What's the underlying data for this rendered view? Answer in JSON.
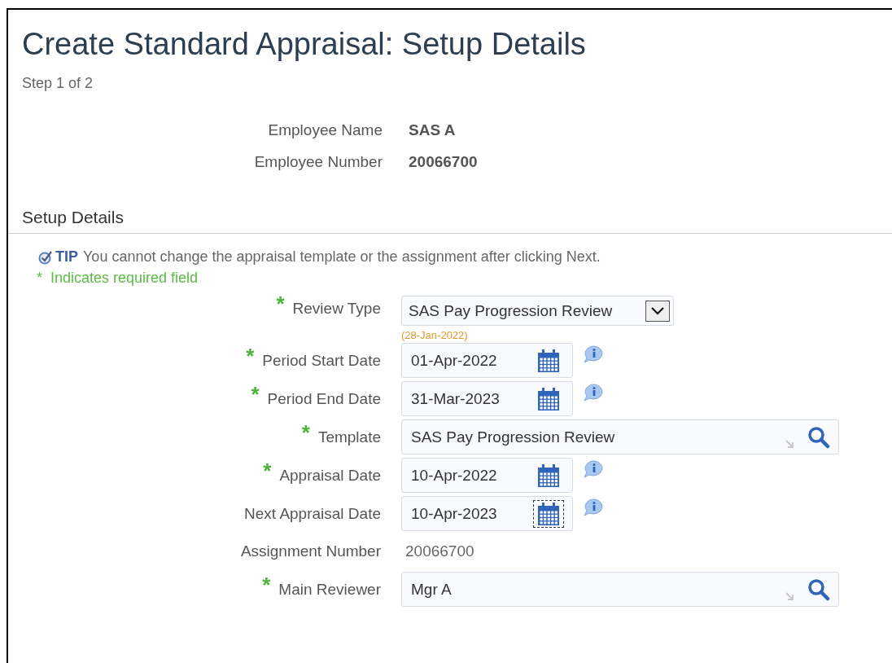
{
  "page": {
    "title": "Create Standard Appraisal: Setup Details",
    "step": "Step 1 of 2"
  },
  "employee": [
    {
      "label": "Employee Name",
      "value": "SAS A"
    },
    {
      "label": "Employee Number",
      "value": "20066700"
    }
  ],
  "section": {
    "title": "Setup Details",
    "tip_label": "TIP",
    "tip_text": "You cannot change the appraisal template or the assignment after clicking Next.",
    "required_mark": "*",
    "required_note": "Indicates required field"
  },
  "fields": [
    {
      "kind": "select",
      "label": "Review Type",
      "required": true,
      "value": "SAS Pay Progression Review"
    },
    {
      "kind": "date",
      "label": "Period Start Date",
      "required": true,
      "value": "01-Apr-2022",
      "hint": "(28-Jan-2022)",
      "calendar_focused": false
    },
    {
      "kind": "date",
      "label": "Period End Date",
      "required": true,
      "value": "31-Mar-2023",
      "calendar_focused": false
    },
    {
      "kind": "lov",
      "label": "Template",
      "required": true,
      "value": "SAS Pay Progression Review"
    },
    {
      "kind": "date",
      "label": "Appraisal Date",
      "required": true,
      "value": "10-Apr-2022",
      "calendar_focused": false
    },
    {
      "kind": "date",
      "label": "Next Appraisal Date",
      "required": false,
      "value": "10-Apr-2023",
      "calendar_focused": true
    },
    {
      "kind": "text",
      "label": "Assignment Number",
      "required": false,
      "value": "20066700"
    },
    {
      "kind": "lov",
      "label": "Main Reviewer",
      "required": true,
      "value": "Mgr A"
    }
  ]
}
